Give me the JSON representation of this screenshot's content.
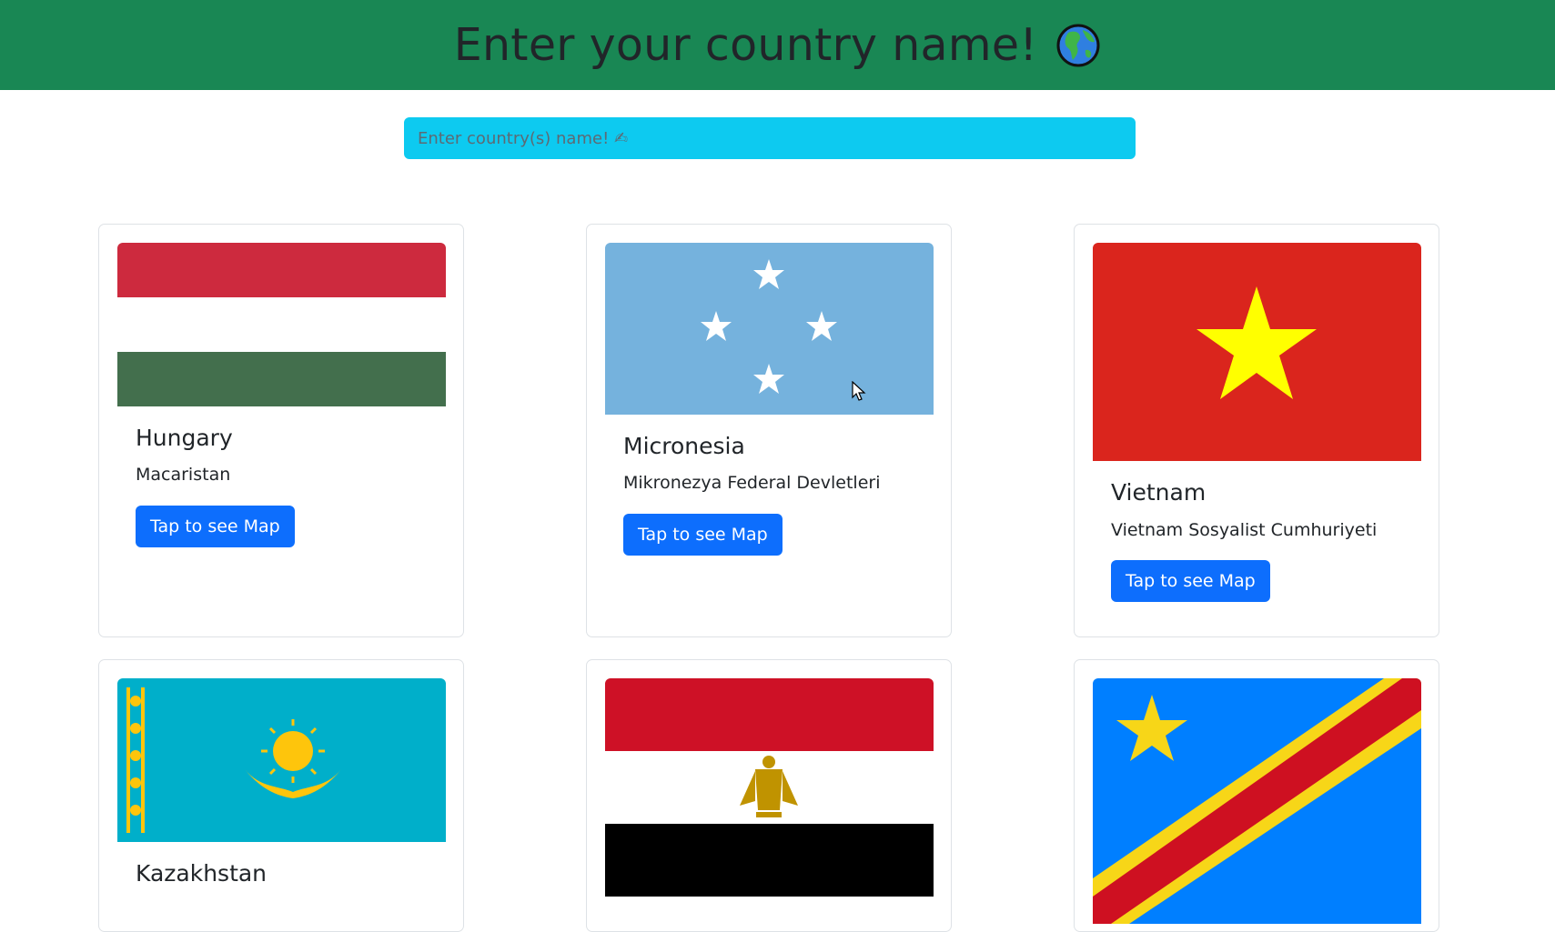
{
  "header": {
    "title": "Enter your country name!",
    "icon": "globe-icon"
  },
  "search": {
    "placeholder": "Enter country(s) name! ✍"
  },
  "cards": [
    {
      "name": "Hungary",
      "native": "Macaristan",
      "button": "Tap to see Map",
      "flag_icon": "hungary-flag"
    },
    {
      "name": "Micronesia",
      "native": "Mikronezya Federal Devletleri",
      "button": "Tap to see Map",
      "flag_icon": "micronesia-flag"
    },
    {
      "name": "Vietnam",
      "native": "Vietnam Sosyalist Cumhuriyeti",
      "button": "Tap to see Map",
      "flag_icon": "vietnam-flag"
    },
    {
      "name": "Kazakhstan",
      "flag_icon": "kazakhstan-flag"
    },
    {
      "flag_icon": "egypt-flag"
    },
    {
      "flag_icon": "dr-congo-flag"
    }
  ],
  "colors": {
    "header": "#198754",
    "search": "#0dcaf0",
    "button": "#0d6efd"
  }
}
